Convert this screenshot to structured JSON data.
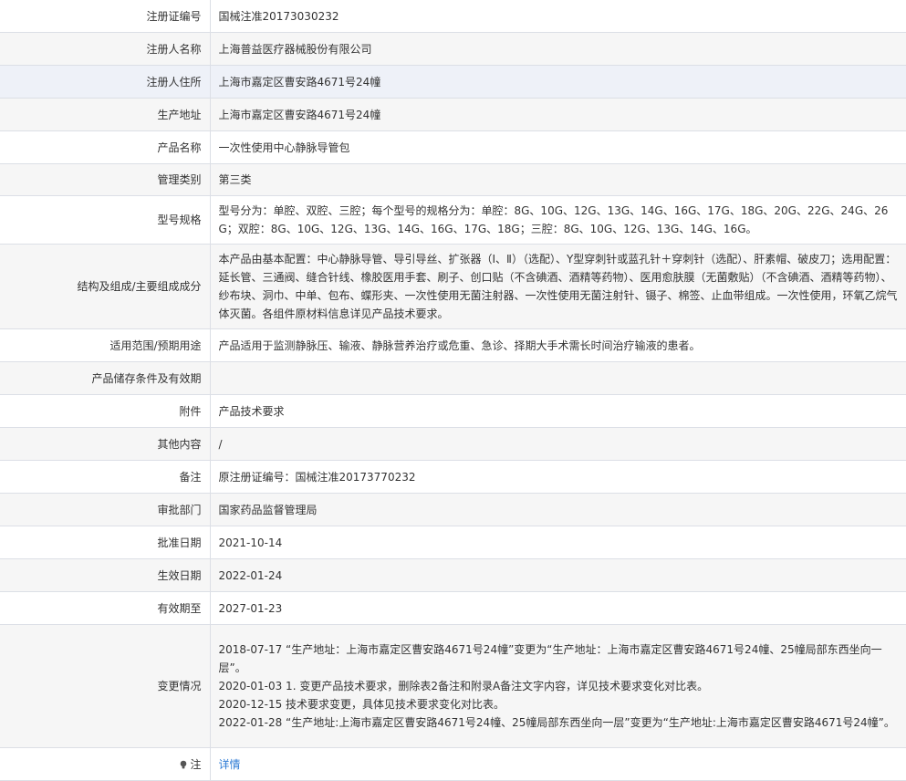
{
  "rows": {
    "reg_no": {
      "label": "注册证编号",
      "value": "国械注准20173030232"
    },
    "registrant_name": {
      "label": "注册人名称",
      "value": "上海普益医疗器械股份有限公司"
    },
    "registrant_address": {
      "label": "注册人住所",
      "value": "上海市嘉定区曹安路4671号24幢"
    },
    "production_address": {
      "label": "生产地址",
      "value": "上海市嘉定区曹安路4671号24幢"
    },
    "product_name": {
      "label": "产品名称",
      "value": "一次性使用中心静脉导管包"
    },
    "category": {
      "label": "管理类别",
      "value": "第三类"
    },
    "model_spec": {
      "label": "型号规格",
      "value": "型号分为：单腔、双腔、三腔；每个型号的规格分为：单腔：8G、10G、12G、13G、14G、16G、17G、18G、20G、22G、24G、26G；双腔：8G、10G、12G、13G、14G、16G、17G、18G；三腔：8G、10G、12G、13G、14G、16G。"
    },
    "structure": {
      "label": "结构及组成/主要组成成分",
      "value": "本产品由基本配置：中心静脉导管、导引导丝、扩张器（Ⅰ、Ⅱ）（选配）、Y型穿刺针或蓝孔针＋穿刺针（选配）、肝素帽、破皮刀；选用配置：延长管、三通阀、缝合针线、橡胶医用手套、刷子、创口贴（不含碘酒、酒精等药物）、医用愈肤膜（无菌敷贴）（不含碘酒、酒精等药物）、纱布块、洞巾、中单、包布、蝶形夹、一次性使用无菌注射器、一次性使用无菌注射针、镊子、棉签、止血带组成。一次性使用，环氧乙烷气体灭菌。各组件原材料信息详见产品技术要求。"
    },
    "scope": {
      "label": "适用范围/预期用途",
      "value": "产品适用于监测静脉压、输液、静脉营养治疗或危重、急诊、择期大手术需长时间治疗输液的患者。"
    },
    "storage": {
      "label": "产品储存条件及有效期",
      "value": ""
    },
    "attachment": {
      "label": "附件",
      "value": "产品技术要求"
    },
    "other": {
      "label": "其他内容",
      "value": "/"
    },
    "remark": {
      "label": "备注",
      "value": "原注册证编号：国械注准20173770232"
    },
    "dept": {
      "label": "审批部门",
      "value": "国家药品监督管理局"
    },
    "approval_date": {
      "label": "批准日期",
      "value": "2021-10-14"
    },
    "effective_date": {
      "label": "生效日期",
      "value": "2022-01-24"
    },
    "expiry_date": {
      "label": "有效期至",
      "value": "2027-01-23"
    },
    "changes": {
      "label": "变更情况",
      "items": [
        "2018-07-17 “生产地址：上海市嘉定区曹安路4671号24幢”变更为“生产地址：上海市嘉定区曹安路4671号24幢、25幢局部东西坐向一层”。",
        "2020-01-03 1. 变更产品技术要求，删除表2备注和附录A备注文字内容，详见技术要求变化对比表。",
        "2020-12-15 技术要求变更，具体见技术要求变化对比表。",
        "2022-01-28 “生产地址:上海市嘉定区曹安路4671号24幢、25幢局部东西坐向一层”变更为“生产地址:上海市嘉定区曹安路4671号24幢”。"
      ]
    },
    "note": {
      "label": "注",
      "link": "详情",
      "icon": "bulb-icon"
    }
  }
}
